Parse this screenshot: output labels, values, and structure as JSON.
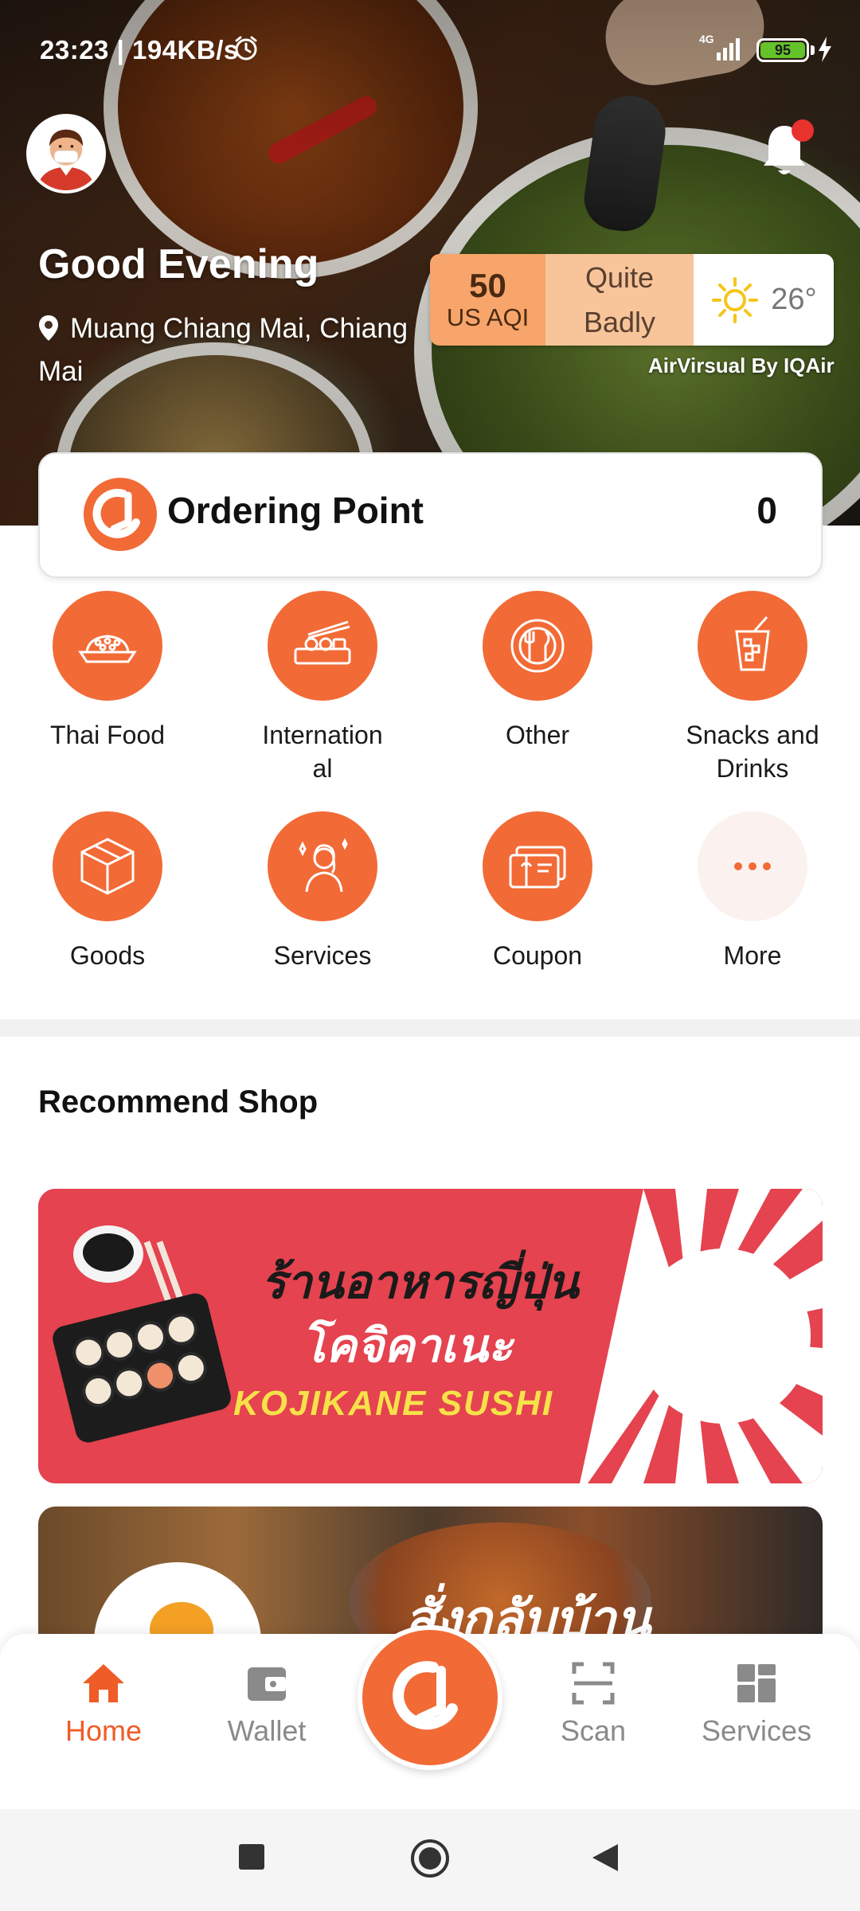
{
  "status_bar": {
    "time": "23:23 | 194KB/s",
    "network": "4G",
    "battery": "95"
  },
  "header": {
    "greeting": "Good Evening",
    "location": "Muang Chiang Mai, Chiang Mai"
  },
  "air_quality": {
    "aqi_value": "50",
    "aqi_unit": "US AQI",
    "status_line1": "Quite",
    "status_line2": "Badly",
    "temperature": "26°",
    "source": "AirVirsual By IQAir"
  },
  "ordering_point": {
    "label": "Ordering Point",
    "value": "0"
  },
  "categories": [
    {
      "label": "Thai Food",
      "icon": "thai-food-icon"
    },
    {
      "label": "International",
      "icon": "international-food-icon"
    },
    {
      "label": "Other",
      "icon": "other-food-icon"
    },
    {
      "label": "Snacks and Drinks",
      "icon": "drink-icon"
    },
    {
      "label": "Goods",
      "icon": "box-icon"
    },
    {
      "label": "Services",
      "icon": "service-person-icon"
    },
    {
      "label": "Coupon",
      "icon": "coupon-icon"
    },
    {
      "label": "More",
      "icon": "more-dots-icon"
    }
  ],
  "recommend": {
    "title": "Recommend Shop",
    "banner1": {
      "line1": "ร้านอาหารญี่ปุ่น",
      "line2": "โคจิคาเนะ",
      "line3": "KOJIKANE SUSHI"
    },
    "banner2": {
      "text": "สั่งกลับบ้าน"
    }
  },
  "bottom_nav": {
    "home": "Home",
    "wallet": "Wallet",
    "scan": "Scan",
    "services": "Services"
  },
  "colors": {
    "accent": "#f26a36",
    "active_nav": "#ef5c28",
    "aqi_bg": "#f7a56a",
    "banner_red": "#e4434f"
  }
}
